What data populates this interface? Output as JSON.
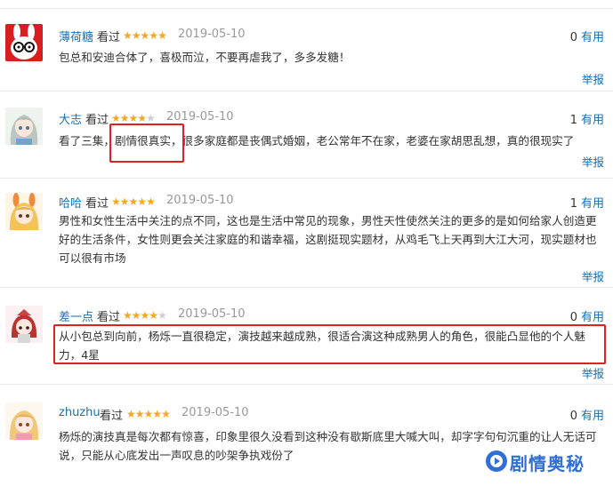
{
  "reviews": [
    {
      "user": "薄荷糖",
      "verb": "看过",
      "rating": 5,
      "date": "2019-05-10",
      "useful_count": "0",
      "useful_label": "有用",
      "content": "包总和安迪合体了，喜极而泣，不要再虐我了，多多发糖！",
      "report": "举报",
      "avatar_icon": "white-rabbit-glasses-avatar"
    },
    {
      "user": "大志",
      "verb": "看过",
      "rating": 4,
      "date": "2019-05-10",
      "useful_count": "1",
      "useful_label": "有用",
      "content": "看了三集，剧情很真实，很多家庭都是丧偶式婚姻，老公常年不在家，老婆在家胡思乱想，真的很现实了",
      "report": "举报",
      "avatar_icon": "anime-girl-silver-hair-avatar"
    },
    {
      "user": "哈哈",
      "verb": "看过",
      "rating": 5,
      "date": "2019-05-10",
      "useful_count": "1",
      "useful_label": "有用",
      "content": "男性和女性生活中关注的点不同，这也是生活中常见的现象，男性天性使然关注的更多的是如何给家人创造更好的生活条件，女性则更会关注家庭的和谐幸福，这剧挺现实题材，从鸡毛飞上天再到大江大河，现实题材也可以很有市场",
      "report": "举报",
      "avatar_icon": "anime-girl-blonde-bunny-avatar"
    },
    {
      "user": "差一点",
      "verb": "看过",
      "rating": 4,
      "date": "2019-05-10",
      "useful_count": "0",
      "useful_label": "有用",
      "content": "从小包总到向前，杨烁一直很稳定，演技越来越成熟，很适合演这种成熟男人的角色，很能凸显他的个人魅力，4星",
      "report": "举报",
      "avatar_icon": "chibi-red-hair-avatar"
    },
    {
      "user": "zhuzhu",
      "verb": "看过",
      "rating": 5,
      "date": "2019-05-10",
      "useful_count": "0",
      "useful_label": "有用",
      "content": "杨烁的演技真是每次都有惊喜，印象里很久没看到这种没有歇斯底里大喊大叫，却字字句句沉重的让人无话可说，只能从心底发出一声叹息的吵架争执戏份了",
      "report": "",
      "avatar_icon": "anime-girl-blonde-pink-avatar"
    }
  ],
  "watermark": {
    "text": "剧情奥秘",
    "icon": "play-logo-icon"
  },
  "colors": {
    "link": "#1a6fb0",
    "star": "#f5a623",
    "highlight": "#e02020",
    "date": "#999999"
  }
}
